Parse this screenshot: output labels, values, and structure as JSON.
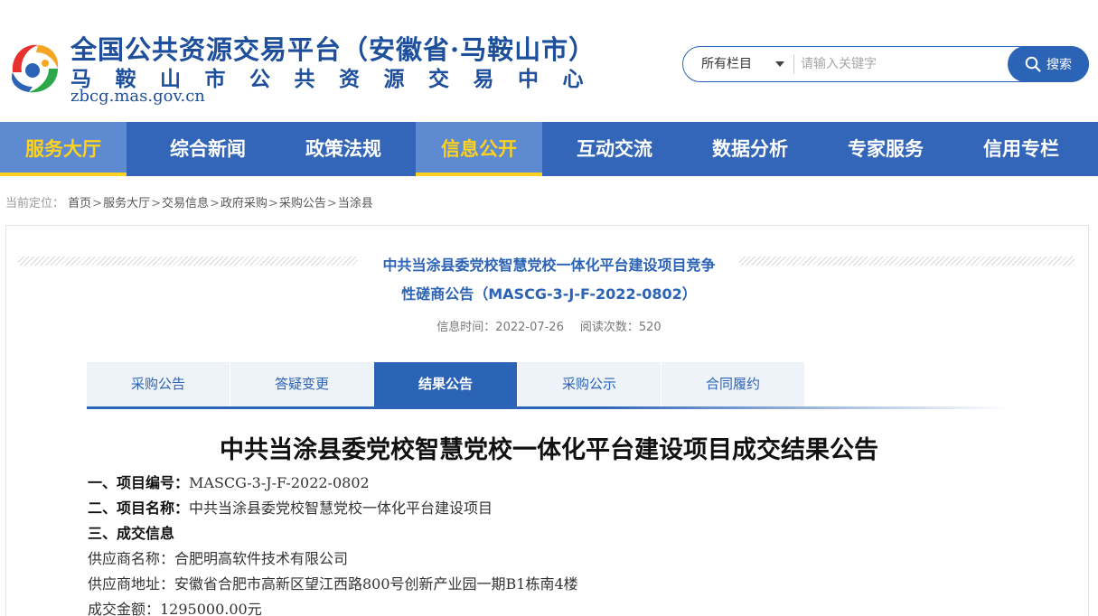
{
  "header": {
    "title_main": "全国公共资源交易平台（安徽省·马鞍山市）",
    "title_sub": "马鞍山市公共资源交易中心",
    "url": "zbcg.mas.gov.cn",
    "logo_icon": "site-logo-icon"
  },
  "search": {
    "category": "所有栏目",
    "placeholder": "请输入关键字",
    "button_label": "搜索"
  },
  "nav": {
    "items": [
      {
        "label": "服务大厅",
        "active": true
      },
      {
        "label": "综合新闻",
        "active": false
      },
      {
        "label": "政策法规",
        "active": false
      },
      {
        "label": "信息公开",
        "active": true
      },
      {
        "label": "互动交流",
        "active": false
      },
      {
        "label": "数据分析",
        "active": false
      },
      {
        "label": "专家服务",
        "active": false
      },
      {
        "label": "信用专栏",
        "active": false
      }
    ]
  },
  "breadcrumb": {
    "prefix": "当前定位：",
    "items": [
      "首页",
      "服务大厅",
      "交易信息",
      "政府采购",
      "采购公告",
      "当涂县"
    ],
    "separator": ">"
  },
  "notice": {
    "title_line1": "中共当涂县委党校智慧党校一体化平台建设项目竞争",
    "title_line2": "性磋商公告（MASCG-3-J-F-2022-0802）",
    "info_time": "信息时间：2022-07-26",
    "view_count": "阅读次数：520"
  },
  "tabs": {
    "items": [
      {
        "label": "采购公告",
        "active": false
      },
      {
        "label": "答疑变更",
        "active": false
      },
      {
        "label": "结果公告",
        "active": true
      },
      {
        "label": "采购公示",
        "active": false
      },
      {
        "label": "合同履约",
        "active": false
      }
    ]
  },
  "article": {
    "title": "中共当涂县委党校智慧党校一体化平台建设项目成交结果公告",
    "lines": [
      {
        "key": "一、项目编号：",
        "value": "MASCG-3-J-F-2022-0802"
      },
      {
        "key": "二、项目名称：",
        "value": "中共当涂县委党校智慧党校一体化平台建设项目"
      },
      {
        "key": "三、成交信息",
        "value": ""
      },
      {
        "key": "",
        "value": "供应商名称：合肥明高软件技术有限公司"
      },
      {
        "key": "",
        "value": "供应商地址：安徽省合肥市高新区望江西路800号创新产业园一期B1栋南4楼"
      },
      {
        "key": "",
        "value": "成交金额：1295000.00元"
      }
    ]
  },
  "colors": {
    "brand_blue": "#2b63b6",
    "nav_blue": "#3366b8",
    "nav_active_text": "#ffd21f"
  }
}
